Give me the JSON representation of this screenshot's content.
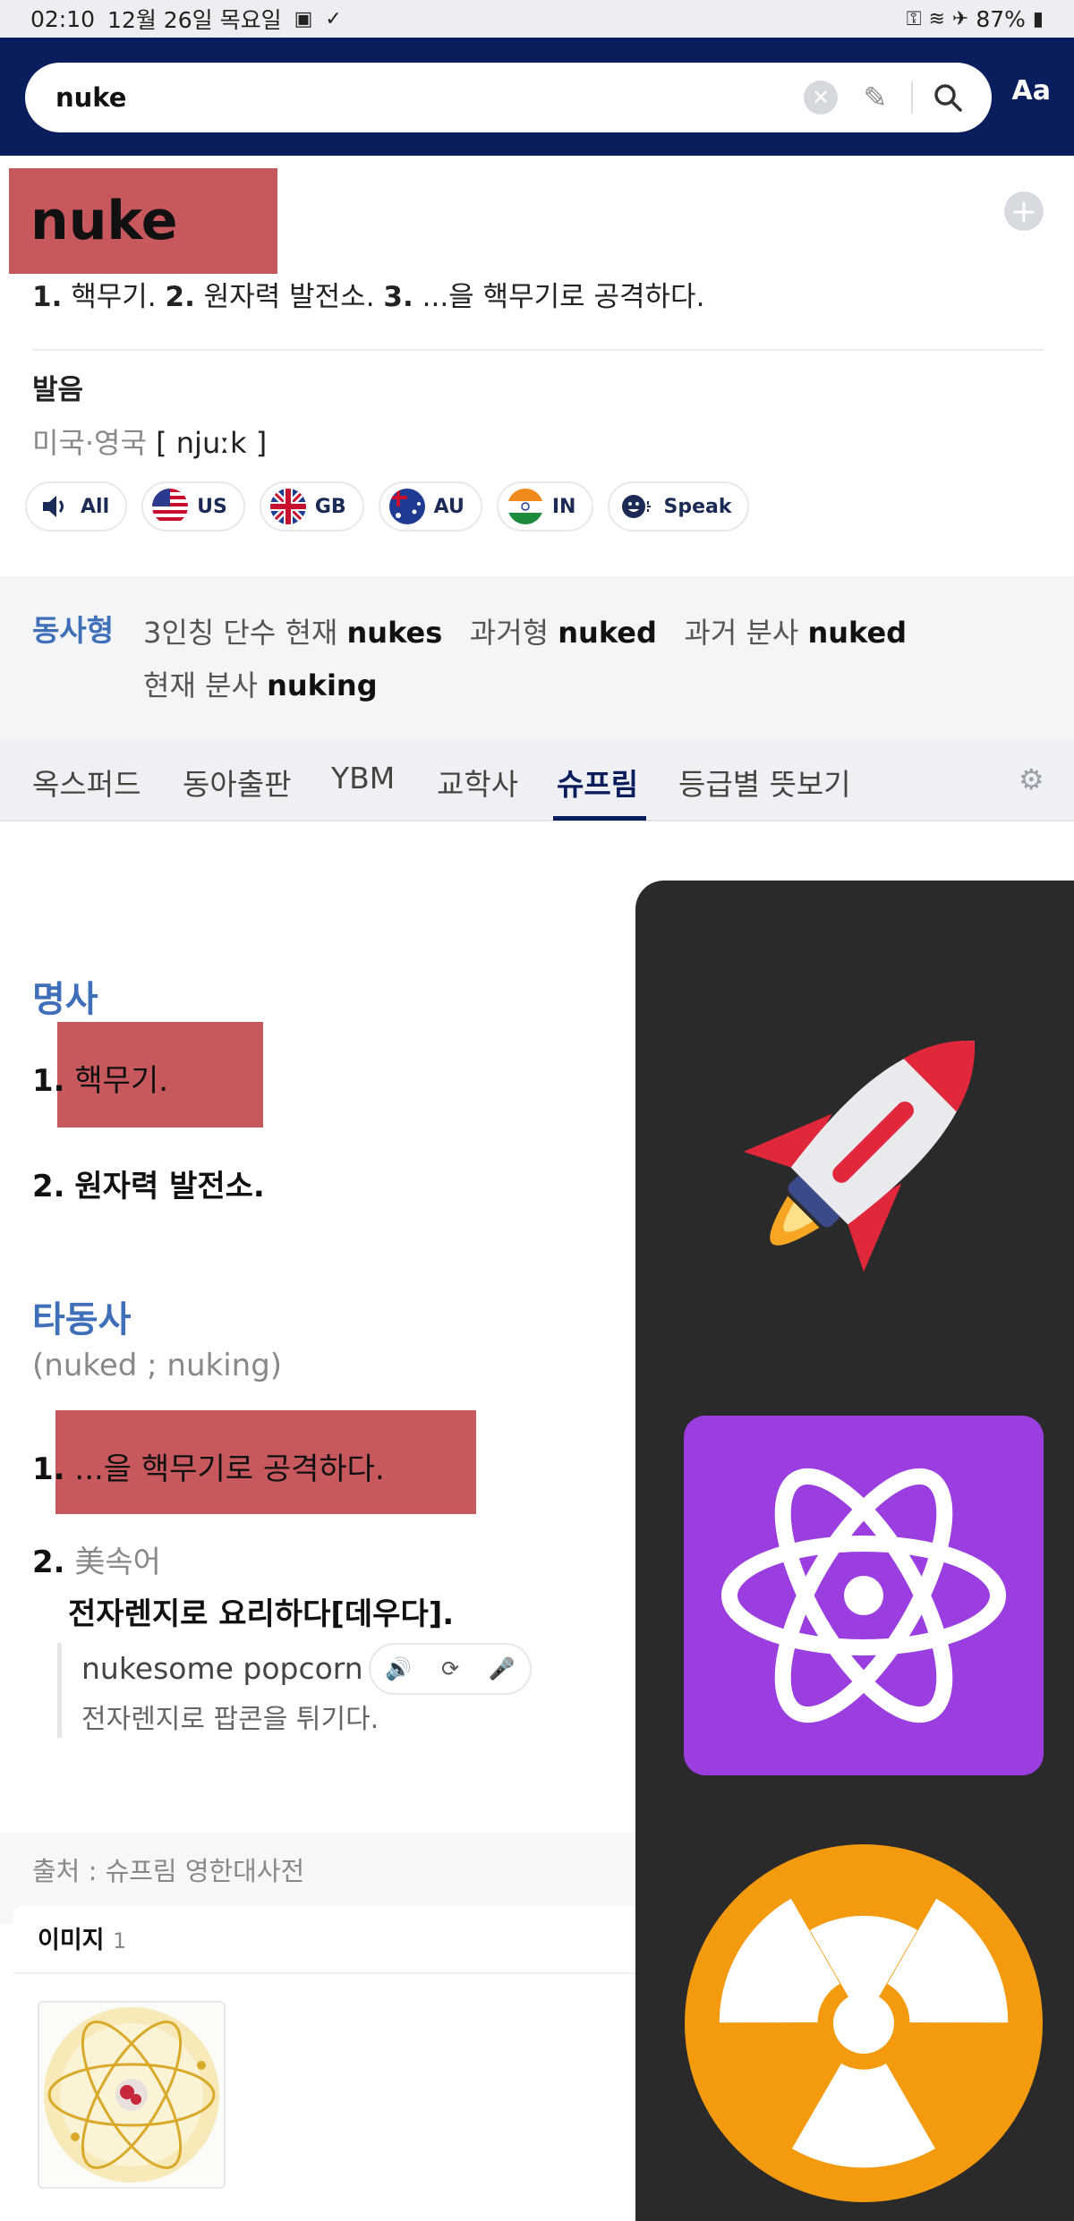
{
  "status_bar": {
    "time": "02:10",
    "date": "12월 26일 목요일",
    "battery": "87%"
  },
  "search": {
    "query": "nuke",
    "font_button": "Aa"
  },
  "entry": {
    "headword": "nuke",
    "summary": [
      {
        "num": "1.",
        "text": "핵무기."
      },
      {
        "num": "2.",
        "text": "원자력 발전소."
      },
      {
        "num": "3.",
        "text": "...을 핵무기로 공격하다."
      }
    ],
    "pronunciation": {
      "title": "발음",
      "region": "미국·영국",
      "ipa": "[ njuːk ]"
    },
    "audio_buttons": [
      "All",
      "US",
      "GB",
      "AU",
      "IN",
      "Speak"
    ]
  },
  "verb_forms": {
    "label": "동사형",
    "third_person_label": "3인칭 단수 현재",
    "third_person": "nukes",
    "past_label": "과거형",
    "past": "nuked",
    "past_participle_label": "과거 분사",
    "past_participle": "nuked",
    "present_participle_label": "현재 분사",
    "present_participle": "nuking"
  },
  "dict_tabs": [
    "옥스퍼드",
    "동아출판",
    "YBM",
    "교학사",
    "슈프림",
    "등급별 뜻보기"
  ],
  "active_tab": "슈프림",
  "definitions": {
    "noun": {
      "label": "명사",
      "items": [
        {
          "num": "1.",
          "text": "핵무기."
        },
        {
          "num": "2.",
          "text": "원자력 발전소."
        }
      ]
    },
    "verb": {
      "label": "타동사",
      "forms": "(nuked ; nuking)",
      "items": [
        {
          "num": "1.",
          "text": "...을 핵무기로 공격하다."
        },
        {
          "num": "2.",
          "label": "美속어",
          "text": "전자렌지로 요리하다[데우다]."
        }
      ],
      "example": {
        "en": "nukesome popcorn",
        "ko": "전자렌지로 팝콘을 튀기다."
      }
    }
  },
  "source": "출처 : 슈프림 영한대사전",
  "images_section": {
    "title": "이미지",
    "count": "1"
  },
  "emoji_panel": [
    "rocket-emoji",
    "atom-symbol-emoji",
    "radioactive-emoji"
  ],
  "colors": {
    "header_navy": "#0a1d5c",
    "highlight_red": "#c6585e",
    "pos_blue": "#3f6fb8",
    "panel_dark": "#2a2a2a"
  }
}
